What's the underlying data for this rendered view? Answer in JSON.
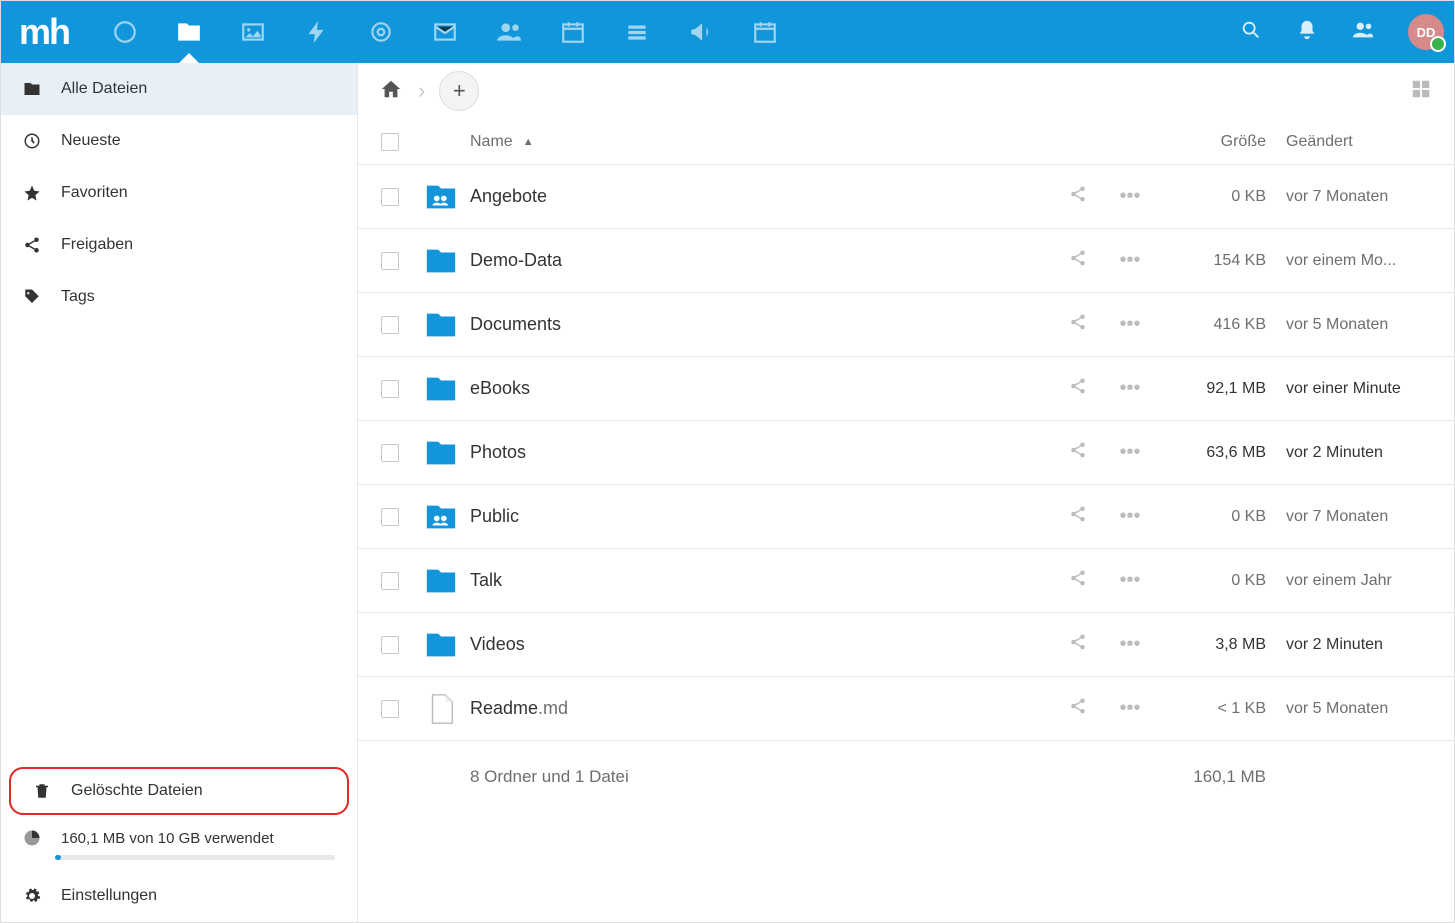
{
  "brand": "mh",
  "avatar_initials": "DD",
  "sidebar": {
    "items": [
      {
        "label": "Alle Dateien",
        "icon": "folder"
      },
      {
        "label": "Neueste",
        "icon": "clock"
      },
      {
        "label": "Favoriten",
        "icon": "star"
      },
      {
        "label": "Freigaben",
        "icon": "share"
      },
      {
        "label": "Tags",
        "icon": "tag"
      }
    ],
    "trash_label": "Gelöschte Dateien",
    "quota_label": "160,1 MB von 10 GB verwendet",
    "settings_label": "Einstellungen"
  },
  "table": {
    "headers": {
      "name": "Name",
      "size": "Größe",
      "modified": "Geändert"
    },
    "rows": [
      {
        "name": "Angebote",
        "ext": "",
        "icon": "folder-shared",
        "size": "0 KB",
        "modified": "vor 7 Monaten",
        "bold": false
      },
      {
        "name": "Demo-Data",
        "ext": "",
        "icon": "folder",
        "size": "154 KB",
        "modified": "vor einem Mo...",
        "bold": false
      },
      {
        "name": "Documents",
        "ext": "",
        "icon": "folder",
        "size": "416 KB",
        "modified": "vor 5 Monaten",
        "bold": false
      },
      {
        "name": "eBooks",
        "ext": "",
        "icon": "folder",
        "size": "92,1 MB",
        "modified": "vor einer Minute",
        "bold": true
      },
      {
        "name": "Photos",
        "ext": "",
        "icon": "folder",
        "size": "63,6 MB",
        "modified": "vor 2 Minuten",
        "bold": true
      },
      {
        "name": "Public",
        "ext": "",
        "icon": "folder-shared",
        "size": "0 KB",
        "modified": "vor 7 Monaten",
        "bold": false
      },
      {
        "name": "Talk",
        "ext": "",
        "icon": "folder",
        "size": "0 KB",
        "modified": "vor einem Jahr",
        "bold": false
      },
      {
        "name": "Videos",
        "ext": "",
        "icon": "folder",
        "size": "3,8 MB",
        "modified": "vor 2 Minuten",
        "bold": true
      },
      {
        "name": "Readme",
        "ext": ".md",
        "icon": "file",
        "size": "< 1 KB",
        "modified": "vor 5 Monaten",
        "bold": false
      }
    ],
    "summary_label": "8 Ordner und 1 Datei",
    "summary_size": "160,1 MB"
  }
}
